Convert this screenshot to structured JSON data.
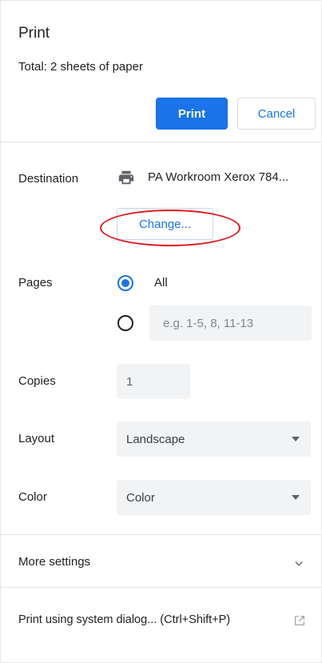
{
  "header": {
    "title": "Print",
    "total": "Total: 2 sheets of paper",
    "print_label": "Print",
    "cancel_label": "Cancel"
  },
  "destination": {
    "label": "Destination",
    "value": "PA Workroom Xerox 784...",
    "icon": "printer-icon",
    "change_label": "Change..."
  },
  "pages": {
    "label": "Pages",
    "options": [
      {
        "label": "All",
        "selected": true
      },
      {
        "placeholder": "e.g. 1-5, 8, 11-13",
        "selected": false
      }
    ]
  },
  "copies": {
    "label": "Copies",
    "value": "1"
  },
  "layout": {
    "label": "Layout",
    "value": "Landscape"
  },
  "color": {
    "label": "Color",
    "value": "Color"
  },
  "more_settings": {
    "label": "More settings",
    "icon": "chevron-down-icon"
  },
  "system_dialog": {
    "label": "Print using system dialog... (Ctrl+Shift+P)",
    "icon": "open-external-icon"
  },
  "colors": {
    "accent": "#1a73e8",
    "annotation": "#e0161c",
    "field_bg": "#f1f3f4"
  }
}
